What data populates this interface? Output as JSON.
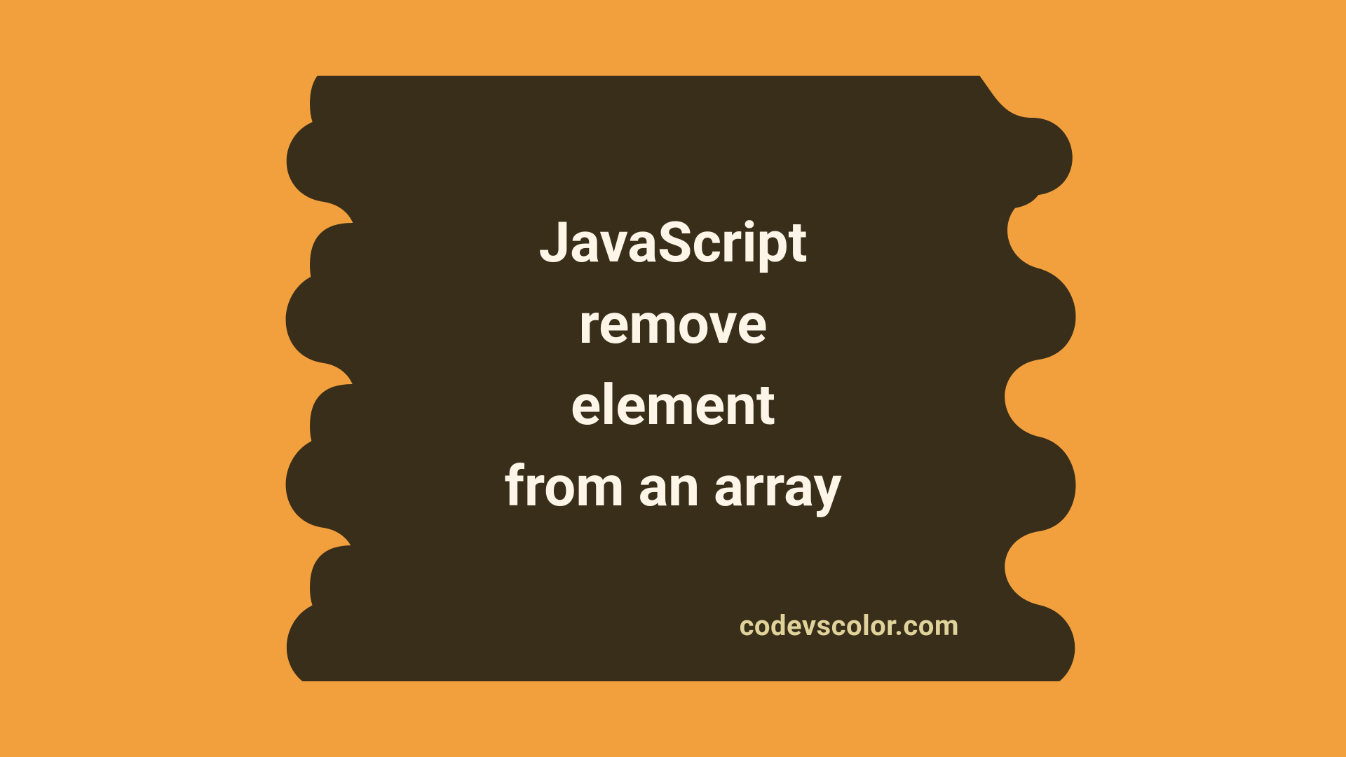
{
  "title_lines": [
    "JavaScript",
    "remove",
    "element",
    "from an array"
  ],
  "credit": "codevscolor.com",
  "colors": {
    "bg": "#f2a03d",
    "blob": "#382e19",
    "text": "#fcf5e8",
    "credit": "#e0d29b"
  }
}
